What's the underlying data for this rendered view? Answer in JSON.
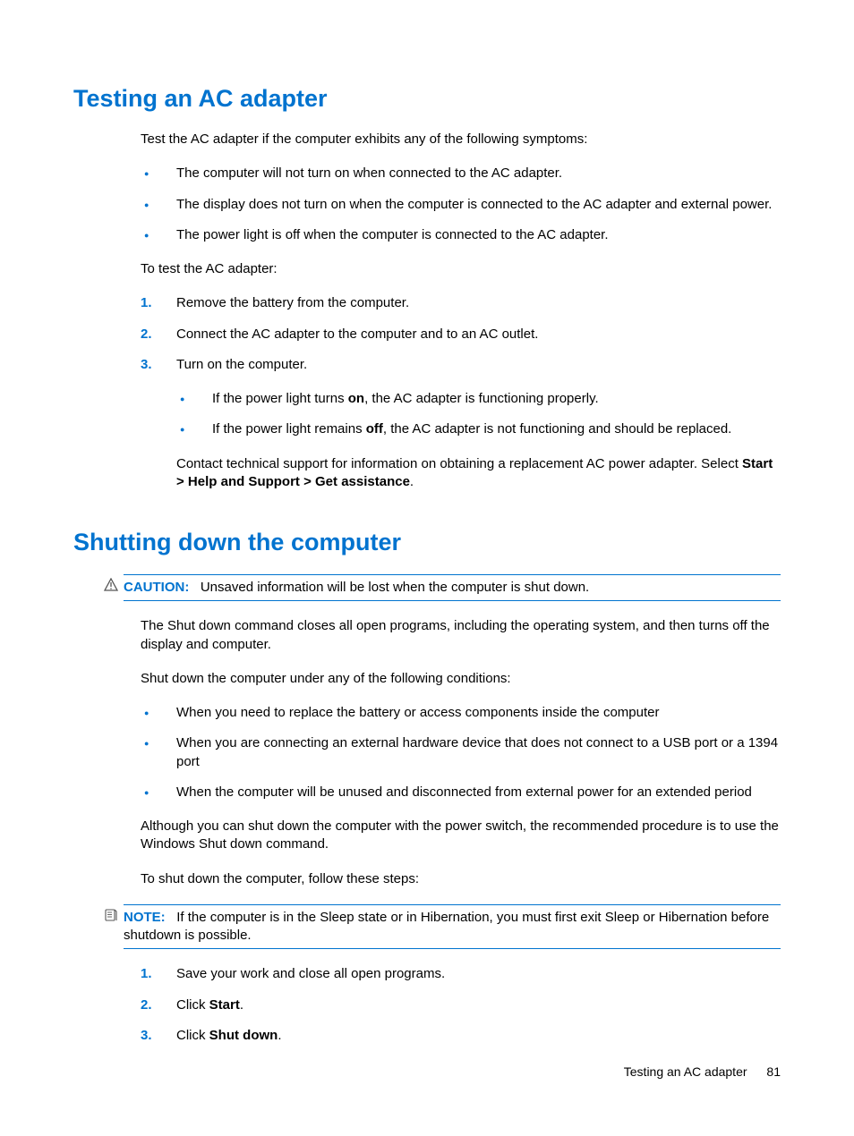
{
  "section1": {
    "heading": "Testing an AC adapter",
    "intro": "Test the AC adapter if the computer exhibits any of the following symptoms:",
    "symptoms": [
      "The computer will not turn on when connected to the AC adapter.",
      "The display does not turn on when the computer is connected to the AC adapter and external power.",
      "The power light is off when the computer is connected to the AC adapter."
    ],
    "test_intro": "To test the AC adapter:",
    "steps": {
      "s1": "Remove the battery from the computer.",
      "s2": "Connect the AC adapter to the computer and to an AC outlet.",
      "s3": "Turn on the computer."
    },
    "sub_bullets": {
      "b1_pre": "If the power light turns ",
      "b1_bold": "on",
      "b1_post": ", the AC adapter is functioning properly.",
      "b2_pre": "If the power light remains ",
      "b2_bold": "off",
      "b2_post": ", the AC adapter is not functioning and should be replaced."
    },
    "contact_pre": "Contact technical support for information on obtaining a replacement AC power adapter. Select ",
    "contact_bold": "Start > Help and Support > Get assistance",
    "contact_post": "."
  },
  "section2": {
    "heading": "Shutting down the computer",
    "caution_label": "CAUTION:",
    "caution_text": "Unsaved information will be lost when the computer is shut down.",
    "para1": "The Shut down command closes all open programs, including the operating system, and then turns off the display and computer.",
    "para2": "Shut down the computer under any of the following conditions:",
    "conditions": [
      "When you need to replace the battery or access components inside the computer",
      "When you are connecting an external hardware device that does not connect to a USB port or a 1394 port",
      "When the computer will be unused and disconnected from external power for an extended period"
    ],
    "para3": "Although you can shut down the computer with the power switch, the recommended procedure is to use the Windows Shut down command.",
    "para4": "To shut down the computer, follow these steps:",
    "note_label": "NOTE:",
    "note_text": "If the computer is in the Sleep state or in Hibernation, you must first exit Sleep or Hibernation before shutdown is possible.",
    "steps": {
      "s1": "Save your work and close all open programs.",
      "s2_pre": "Click ",
      "s2_bold": "Start",
      "s2_post": ".",
      "s3_pre": "Click ",
      "s3_bold": "Shut down",
      "s3_post": "."
    }
  },
  "footer": {
    "title": "Testing an AC adapter",
    "page": "81"
  }
}
